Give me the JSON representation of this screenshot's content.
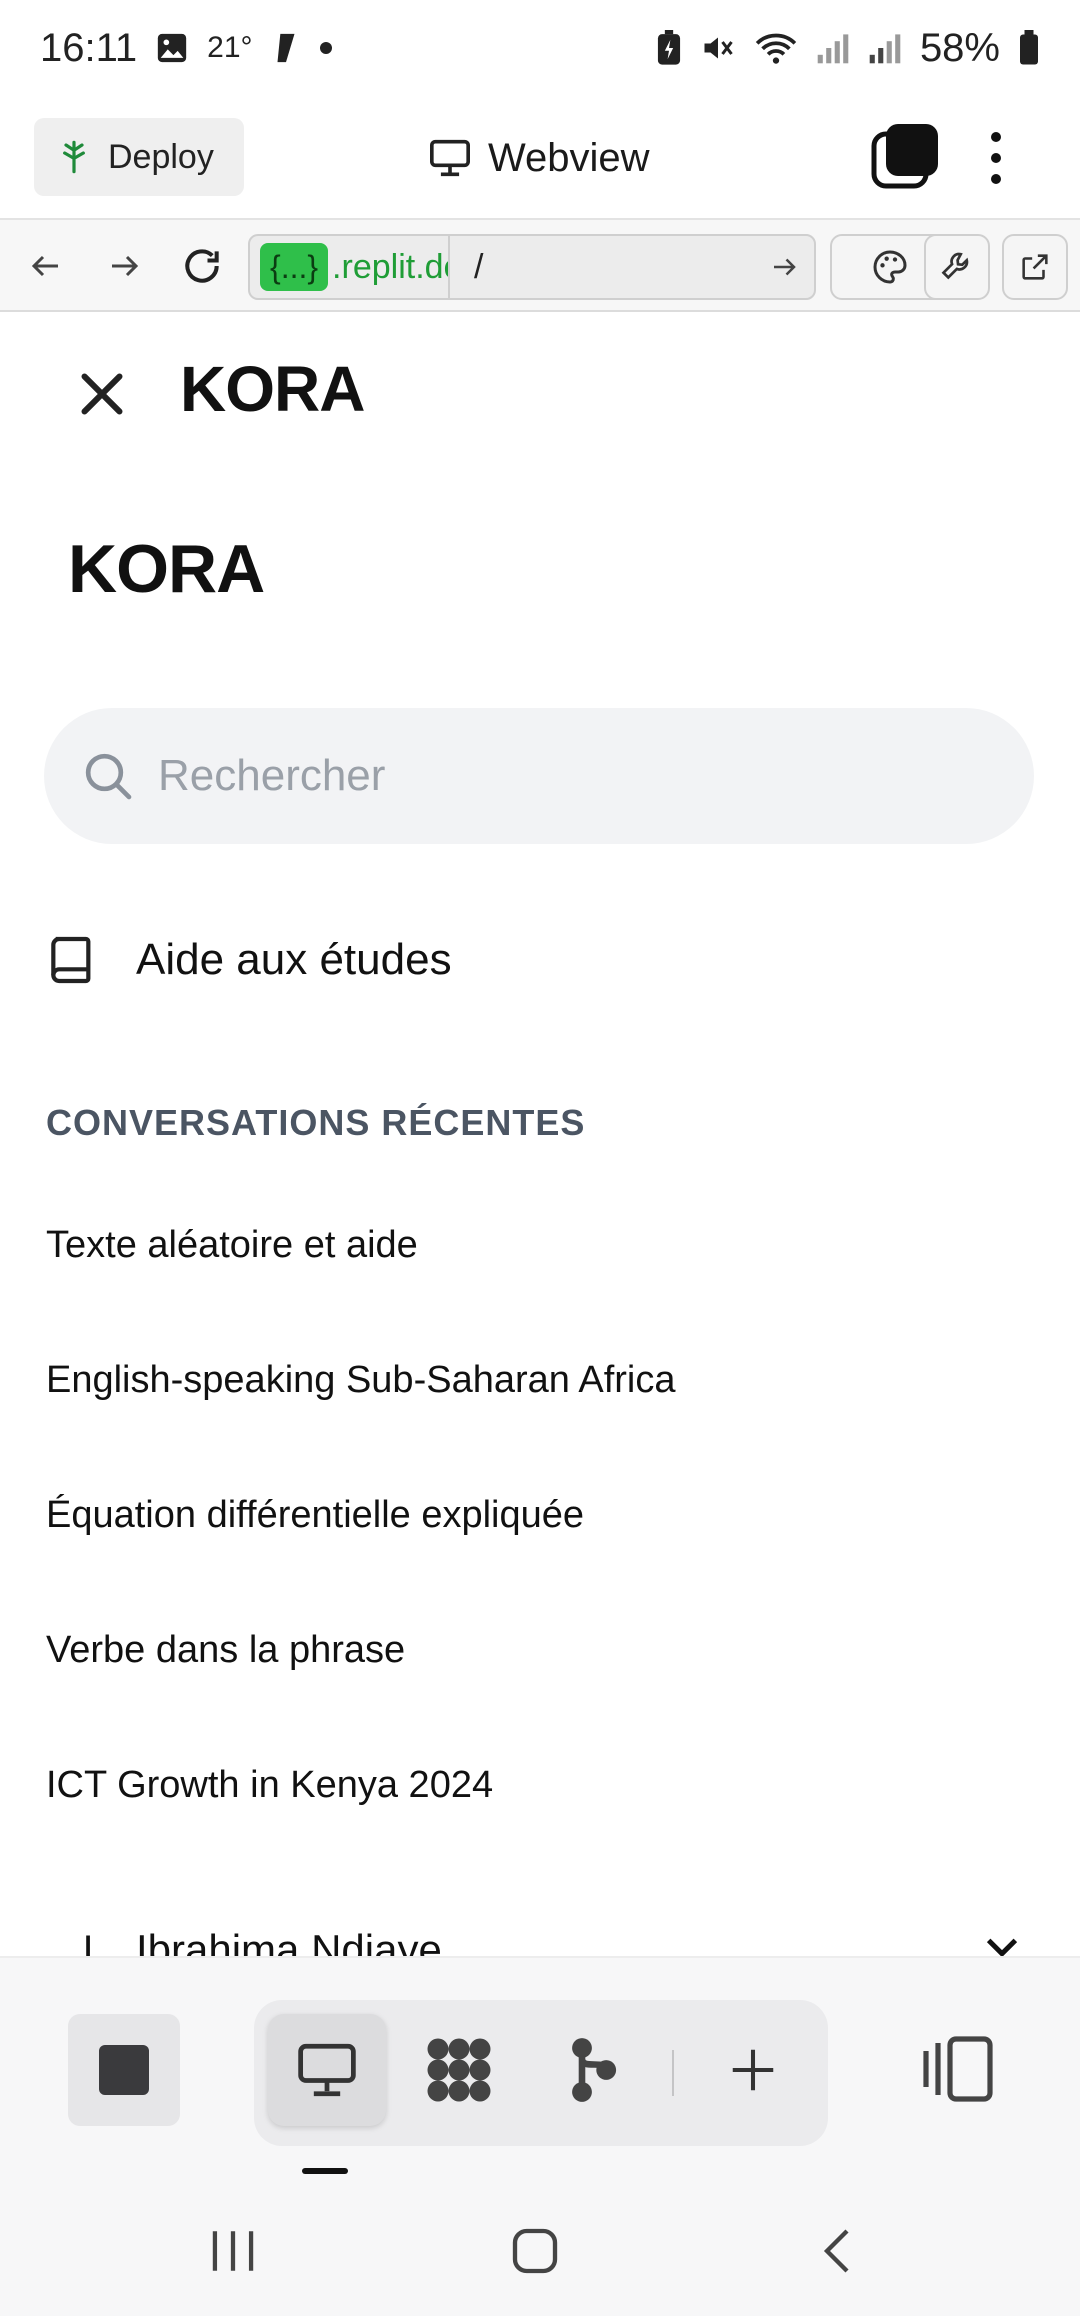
{
  "status_bar": {
    "time": "16:11",
    "temperature": "21°",
    "battery": "58%"
  },
  "top_bar": {
    "deploy_label": "Deploy",
    "webview_label": "Webview"
  },
  "url_bar": {
    "badge": "{...}",
    "host": ".replit.dev",
    "path": "/"
  },
  "app": {
    "header_title": "KORA",
    "sidebar_title": "KORA",
    "search_placeholder": "Rechercher",
    "study_help": "Aide aux études",
    "recent_heading": "CONVERSATIONS RÉCENTES",
    "conversations": [
      "Texte aléatoire et aide",
      "English-speaking Sub-Saharan Africa",
      "Équation différentielle expliquée",
      "Verbe dans la phrase",
      "ICT Growth in Kenya 2024"
    ],
    "user": {
      "initial": "I",
      "name": "Ibrahima Ndiaye"
    }
  },
  "colors": {
    "accent_green": "#2fbf4a",
    "heading_gray": "#4b5563",
    "placeholder_gray": "#9aa0a8"
  }
}
